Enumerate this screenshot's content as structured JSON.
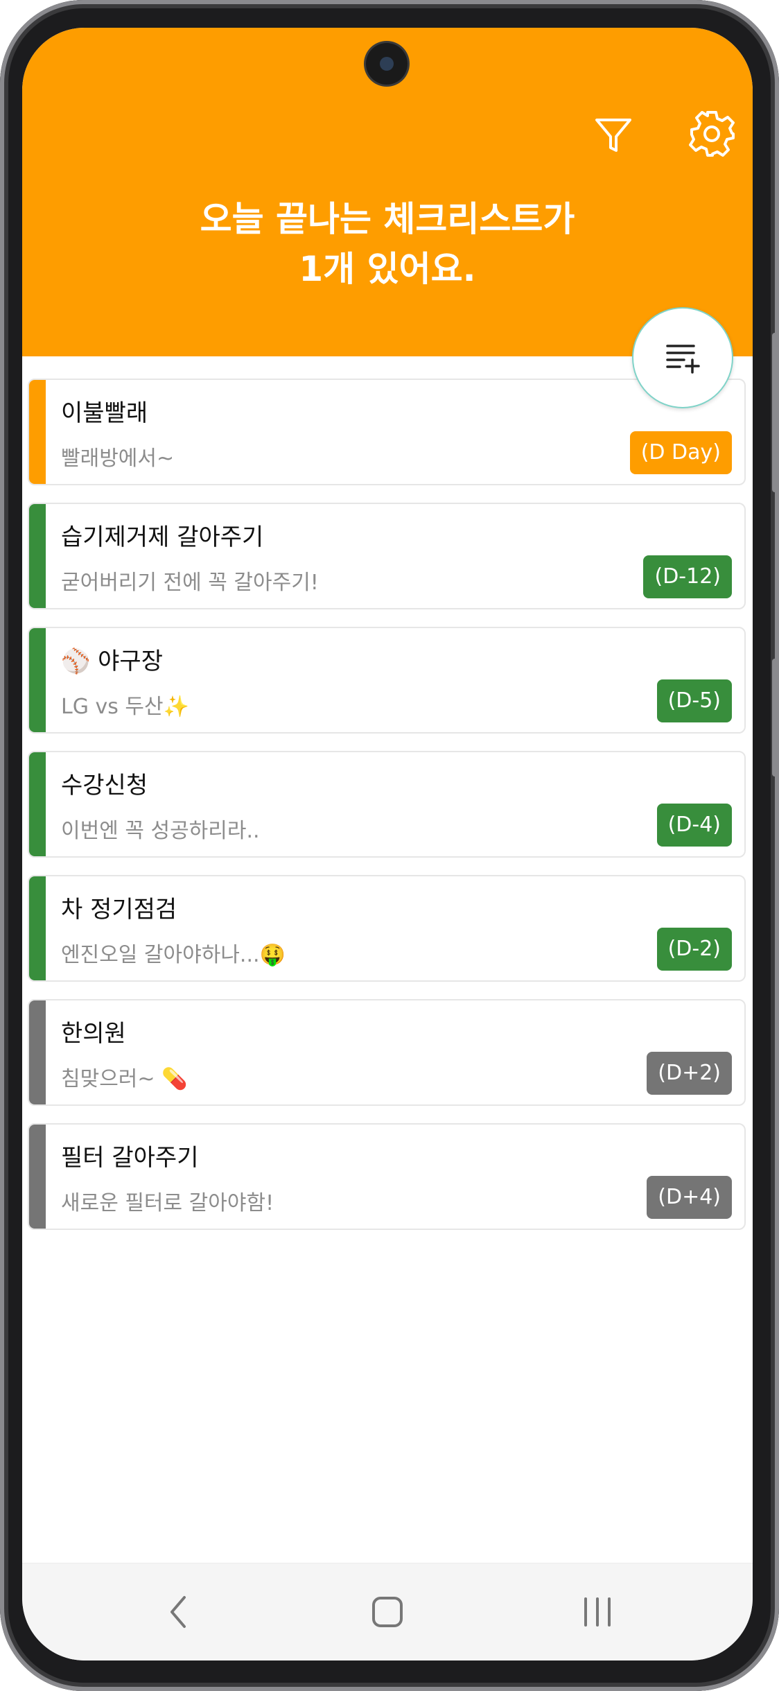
{
  "header": {
    "title_line1": "오늘 끝나는 체크리스트가",
    "title_line2": "1개 있어요.",
    "filter_icon": "filter-icon",
    "settings_icon": "gear-icon",
    "background_color": "#fe9d00"
  },
  "fab": {
    "icon": "add-list-icon"
  },
  "items": [
    {
      "title": "이불빨래",
      "subtitle": "빨래방에서~",
      "badge": "(D Day)",
      "color": "#fe9d00"
    },
    {
      "title": "습기제거제 갈아주기",
      "subtitle": "굳어버리기 전에 꼭 갈아주기!",
      "badge": "(D-12)",
      "color": "#388e3c"
    },
    {
      "title": "⚾ 야구장",
      "subtitle": "LG vs 두산✨",
      "badge": "(D-5)",
      "color": "#388e3c"
    },
    {
      "title": "수강신청",
      "subtitle": "이번엔 꼭 성공하리라..",
      "badge": "(D-4)",
      "color": "#388e3c"
    },
    {
      "title": "차 정기점검",
      "subtitle": "엔진오일 갈아야하나...🤑",
      "badge": "(D-2)",
      "color": "#388e3c"
    },
    {
      "title": "한의원",
      "subtitle": "침맞으러~ 💊",
      "badge": "(D+2)",
      "color": "#757575"
    },
    {
      "title": "필터 갈아주기",
      "subtitle": "새로운 필터로 갈아야함!",
      "badge": "(D+4)",
      "color": "#757575"
    }
  ],
  "nav": {
    "back": "back-icon",
    "home": "home-icon",
    "recents": "recents-icon"
  }
}
